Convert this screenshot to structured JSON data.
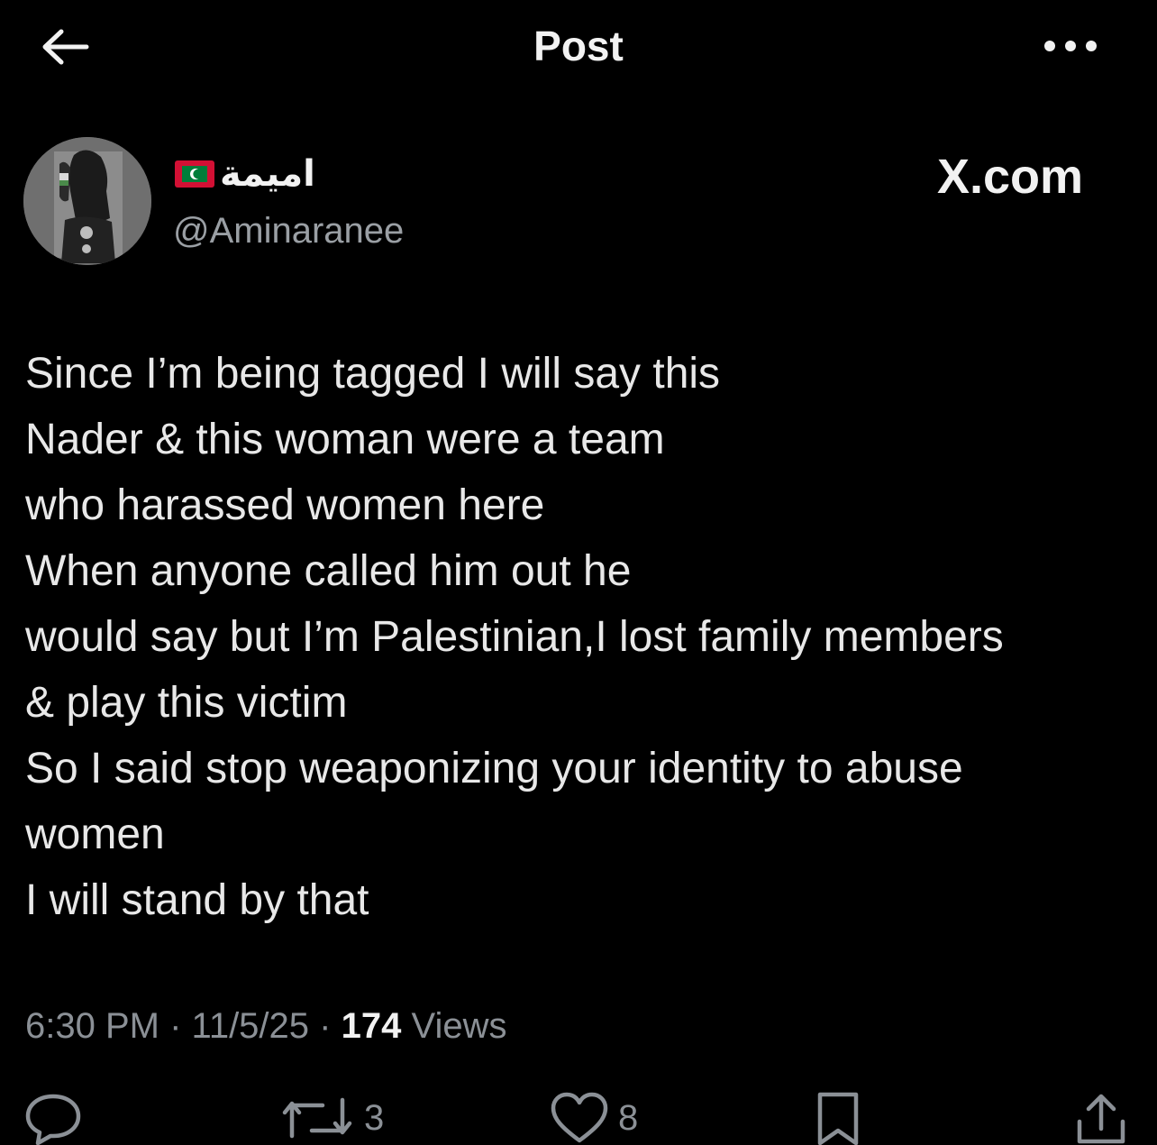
{
  "header": {
    "title": "Post",
    "back_icon": "arrow-left-icon",
    "more_icon": "more-horizontal-icon"
  },
  "author": {
    "display_name": "اميمة",
    "flag_icon": "maldives-flag-icon",
    "handle": "@Aminaranee"
  },
  "brand": "X.com",
  "tweet": {
    "lines": [
      "Since I’m being tagged I will say this",
      "Nader & this woman were a team",
      "who harassed women here",
      "When anyone called him out he",
      "would say but I’m Palestinian,I lost family members",
      "& play this victim",
      "So I said stop weaponizing your identity to abuse",
      "women",
      "I will stand by that"
    ]
  },
  "meta": {
    "time": "6:30 PM",
    "separator": "·",
    "date": "11/5/25",
    "views_count": "174",
    "views_label": "Views"
  },
  "actions": {
    "reply_icon": "reply-icon",
    "repost_icon": "repost-icon",
    "repost_count": "3",
    "like_icon": "heart-icon",
    "like_count": "8",
    "bookmark_icon": "bookmark-icon",
    "share_icon": "share-icon"
  },
  "colors": {
    "background": "#000000",
    "text_primary": "#e7e9ea",
    "text_secondary": "#8b9096"
  }
}
